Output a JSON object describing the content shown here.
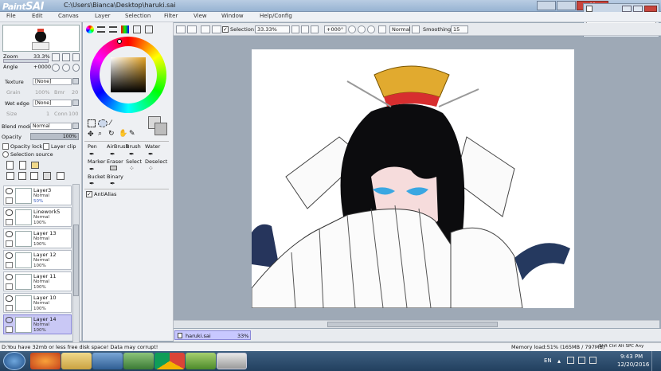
{
  "window": {
    "title": "C:\\Users\\Bianca\\Desktop\\haruki.sai",
    "logo": "PaintTool SAI"
  },
  "menu": [
    "File",
    "Edit",
    "Canvas",
    "Layer",
    "Selection",
    "Filter",
    "View",
    "Window",
    "Help/Config"
  ],
  "navigator": {
    "zoom_label": "Zoom",
    "zoom_value": "33.3%",
    "angle_label": "Angle",
    "angle_value": "+0000"
  },
  "texture": {
    "label": "Texture",
    "value": "[None]",
    "grain_label": "Grain",
    "grain_value": "100%",
    "bmr_label": "Bmr",
    "bmr_value": "20"
  },
  "wet_edge": {
    "label": "Wet edge",
    "value": "[None]",
    "size_label": "Size",
    "size_value": "1",
    "conn_label": "Conn",
    "conn_value": "100"
  },
  "blend": {
    "label": "Blend mode",
    "value": "Normal",
    "opacity_label": "Opacity",
    "opacity_value": "100%",
    "opacity_lock": "Opacity lock",
    "layer_clip": "Layer clip",
    "selection_source": "Selection source"
  },
  "layers": [
    {
      "name": "Layer3",
      "mode": "Normal",
      "opacity": "50%",
      "selected": false
    },
    {
      "name": "Linework5",
      "mode": "Normal",
      "opacity": "100%",
      "selected": false
    },
    {
      "name": "Layer 13",
      "mode": "Normal",
      "opacity": "100%",
      "selected": false
    },
    {
      "name": "Layer 12",
      "mode": "Normal",
      "opacity": "100%",
      "selected": false
    },
    {
      "name": "Layer 11",
      "mode": "Normal",
      "opacity": "100%",
      "selected": false
    },
    {
      "name": "Layer 10",
      "mode": "Normal",
      "opacity": "100%",
      "selected": false
    },
    {
      "name": "Layer 14",
      "mode": "Normal",
      "opacity": "100%",
      "selected": true
    }
  ],
  "tools": {
    "row1": [
      "Pen",
      "AirBrush",
      "Brush",
      "Water"
    ],
    "row2": [
      "Marker",
      "Eraser",
      "Select",
      "Deselect"
    ],
    "row3": [
      "Bucket",
      "Binary"
    ],
    "antialias": "AntiAlias"
  },
  "toolbar": {
    "selection_label": "Selection",
    "zoom": "33.33%",
    "angle": "+000°",
    "mode": "Normal",
    "smoothing_label": "Smoothing",
    "smoothing_value": "15"
  },
  "doc_tab": {
    "name": "haruki.sai",
    "zoom": "33%"
  },
  "status": {
    "warning": "D:You have 32mb or less free disk space! Data may corrupt!",
    "memory": "Memory load:51% (165MB / 797MB)",
    "keys": "Shft Ctrl Alt SPC Any"
  },
  "tray": {
    "lang": "EN",
    "time": "9:43 PM",
    "date": "12/20/2016"
  },
  "colors": {
    "accent": "#c8c8ff",
    "selected_layer": "#c9c8f5"
  }
}
